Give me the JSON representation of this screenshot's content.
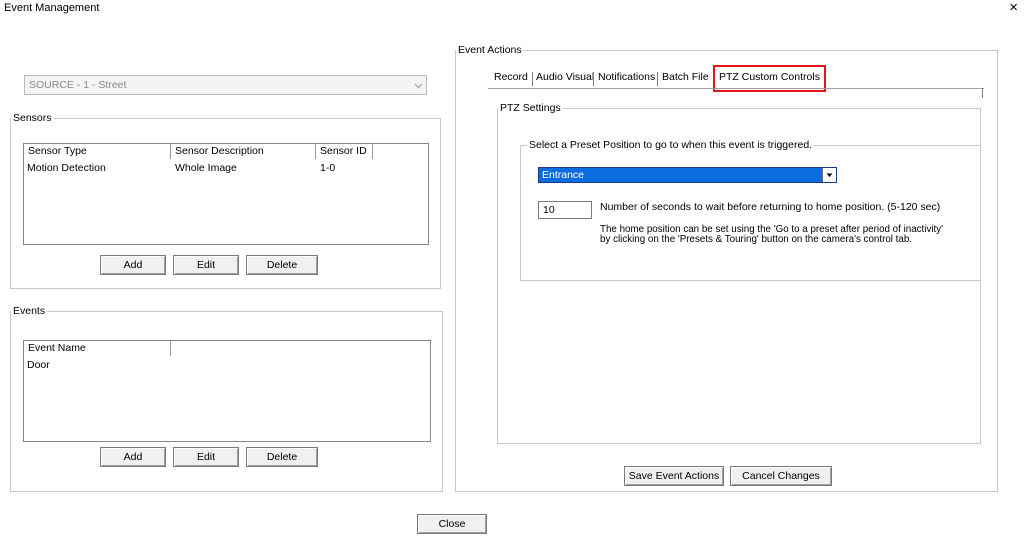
{
  "window": {
    "title": "Event Management",
    "close_glyph": "×"
  },
  "source": {
    "selected": "SOURCE -   1 - Street"
  },
  "sensors": {
    "legend": "Sensors",
    "columns": [
      "Sensor Type",
      "Sensor Description",
      "Sensor ID"
    ],
    "rows": [
      [
        "Motion Detection",
        "Whole Image",
        "1-0"
      ]
    ],
    "add_label": "Add",
    "edit_label": "Edit",
    "delete_label": "Delete"
  },
  "events": {
    "legend": "Events",
    "columns": [
      "Event Name",
      ""
    ],
    "rows": [
      [
        "Door"
      ]
    ],
    "add_label": "Add",
    "edit_label": "Edit",
    "delete_label": "Delete"
  },
  "event_actions": {
    "legend": "Event Actions",
    "tabs": [
      "Record",
      "Audio Visual",
      "Notifications",
      "Batch File",
      "PTZ  Custom Controls"
    ],
    "active_tab": "PTZ  Custom Controls",
    "ptz_settings": {
      "legend": "PTZ Settings",
      "preset_legend": "Select a Preset Position to go to when this event is triggered.",
      "preset_selected": "Entrance",
      "wait_seconds": "10",
      "wait_label": "Number of seconds to wait before returning to home position. (5-120 sec)",
      "home_note_line1": "The home position can be set using the 'Go to a preset after period of inactivity'",
      "home_note_line2": "by clicking on the 'Presets & Touring' button on the camera's control tab."
    },
    "save_label": "Save Event Actions",
    "cancel_label": "Cancel Changes"
  },
  "footer": {
    "close_label": "Close"
  },
  "colors": {
    "active_tab_border": "#e0161d",
    "selection_blue": "#0a6ddf"
  }
}
